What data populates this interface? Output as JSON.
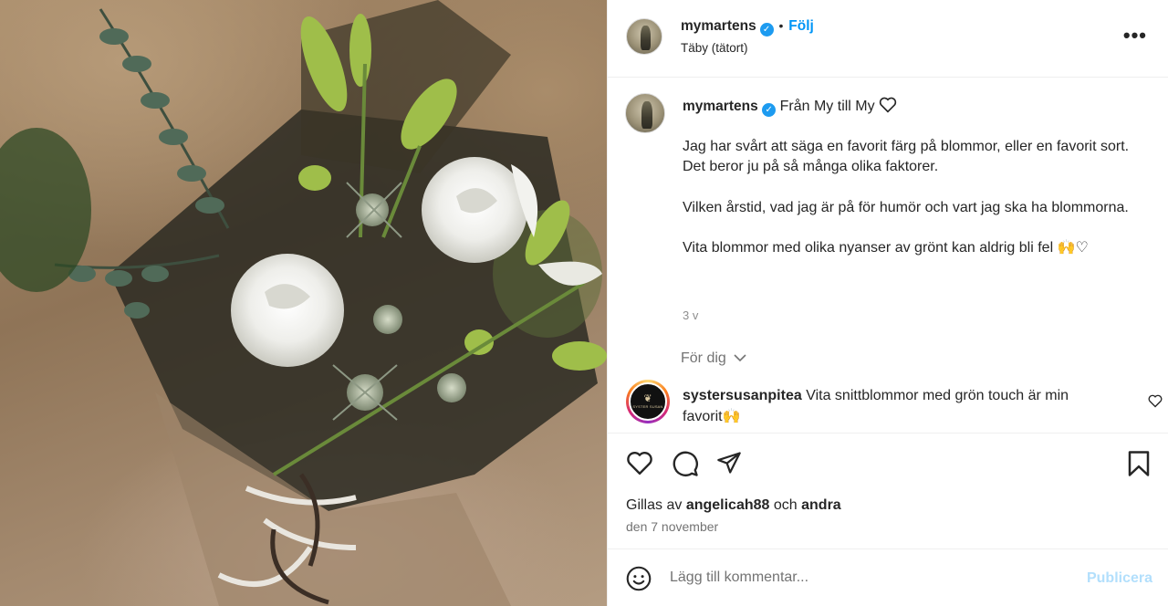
{
  "header": {
    "username": "mymartens",
    "follow_label": "Följ",
    "location": "Täby (tätort)",
    "more_label": "•••"
  },
  "caption": {
    "username": "mymartens",
    "title": "Från My till My",
    "paragraphs": [
      "Jag har svårt att säga en favorit färg på blommor, eller en favorit sort.\nDet beror ju på så många olika faktorer.",
      "Vilken årstid, vad jag är på för humör och vart jag ska ha blommorna.",
      "Vita blommor med olika nyanser av grönt kan aldrig bli fel 🙌♡"
    ],
    "time_ago": "3 v"
  },
  "comments": {
    "filter_label": "För dig",
    "items": [
      {
        "username": "systersusanpitea",
        "text": "Vita snittblommor med grön touch är min favorit🙌",
        "avatar_text": "SYSTER SUSAN"
      }
    ]
  },
  "engagement": {
    "likes_prefix": "Gillas av",
    "liker": "angelicah88",
    "conjunction": "och",
    "others": "andra",
    "date": "den 7 november"
  },
  "composer": {
    "placeholder": "Lägg till kommentar...",
    "publish_label": "Publicera"
  },
  "icons": {
    "verified": "verified-badge-icon",
    "heart": "heart-icon",
    "comment": "comment-icon",
    "share": "share-icon",
    "bookmark": "bookmark-icon",
    "emoji": "emoji-icon",
    "more": "more-options-icon",
    "chevron": "chevron-down-icon"
  },
  "colors": {
    "accent": "#0095f6",
    "verified": "#1d9bf0",
    "publish_disabled": "#b2dffc",
    "muted": "#737373"
  }
}
